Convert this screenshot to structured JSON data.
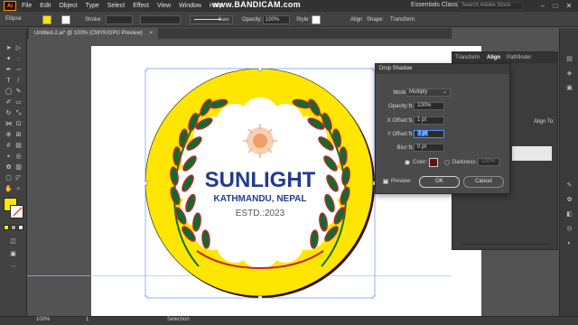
{
  "overlay": {
    "watermark": "www.BANDICAM.com"
  },
  "menubar": {
    "logo": "Ai",
    "items": [
      "File",
      "Edit",
      "Object",
      "Type",
      "Select",
      "Effect",
      "View",
      "Window",
      "Help"
    ],
    "workspace": "Essentials Classic",
    "search_placeholder": "Search Adobe Stock"
  },
  "controlbar": {
    "object_type": "Ellipse",
    "stroke_label": "Stroke:",
    "basic_label": "Basic",
    "opacity_label": "Opacity:",
    "opacity_value": "100%",
    "style_label": "Style:",
    "align_label": "Align",
    "shape_label": "Shape:",
    "transform_label": "Transform"
  },
  "document": {
    "tab_label": "Untitled-2.ai* @ 100% (CMYK/GPU Preview)"
  },
  "logo": {
    "brand": "SUNLIGHT",
    "location": "KATHMANDU, NEPAL",
    "established": "ESTD.:2023",
    "colors": {
      "yellow": "#ffe600",
      "navy": "#243a8f",
      "leaf_green": "#0f6b2e",
      "leaf_red": "#c4262e",
      "sun": "#f0b48a"
    }
  },
  "panels": {
    "tabs": [
      "Transform",
      "Align",
      "Pathfinder"
    ],
    "align_to_label": "Align To:"
  },
  "dialog": {
    "title": "Drop Shadow",
    "mode_label": "Mode:",
    "mode_value": "Multiply",
    "opacity_label": "Opacity:",
    "opacity_value": "100%",
    "x_offset_label": "X Offset:",
    "x_offset_value": "1 pt",
    "y_offset_label": "Y Offset:",
    "y_offset_value": "1 pt",
    "blur_label": "Blur:",
    "blur_value": "0 pt",
    "color_label": "Color:",
    "darkness_label": "Darkness:",
    "darkness_value": "100%",
    "preview_label": "Preview",
    "ok_label": "OK",
    "cancel_label": "Cancel",
    "shadow_color": "#6b1010"
  },
  "statusbar": {
    "zoom": "100%",
    "page": "1",
    "tool": "Selection"
  }
}
